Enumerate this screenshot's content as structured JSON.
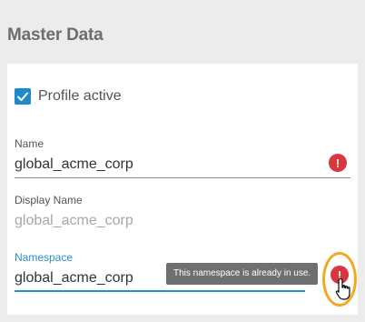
{
  "section": {
    "title": "Master Data"
  },
  "profile": {
    "checkbox_label": "Profile active",
    "checked": true
  },
  "fields": {
    "name": {
      "label": "Name",
      "value": "global_acme_corp"
    },
    "display_name": {
      "label": "Display Name",
      "value": "global_acme_corp"
    },
    "namespace": {
      "label": "Namespace",
      "value": "global_acme_corp"
    }
  },
  "tooltip": {
    "text": "This namespace is already in use."
  },
  "icons": {
    "error": "!",
    "checkbox": "check-icon",
    "cursor": "hand-pointer-icon"
  },
  "colors": {
    "accent": "#2b8fce",
    "error": "#d9363e",
    "highlight": "#f2a91f"
  }
}
